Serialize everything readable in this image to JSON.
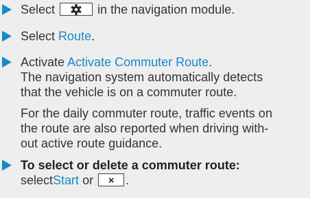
{
  "steps": [
    {
      "pre": "Select",
      "icon": "gear-icon",
      "post": "in the navigation module."
    },
    {
      "pre": "Select",
      "link": "Route",
      "post": "."
    },
    {
      "pre": "Activate",
      "link": "Activate Commuter Route",
      "post": ".",
      "detail_lines": [
        "The navigation system automatically detects",
        "that the vehicle is on a commuter route."
      ]
    },
    {
      "heading": "To select or delete a commuter route:",
      "pre": "select",
      "link": "Start",
      "mid": "or",
      "button_label": "×",
      "post": "."
    }
  ],
  "note_lines": [
    "For the daily commuter route, traffic events on",
    "the route are also reported when driving with-",
    "out active route guidance."
  ],
  "colors": {
    "accent": "#1a88c9",
    "panel_background": "#eeeeee",
    "text": "#333333"
  }
}
